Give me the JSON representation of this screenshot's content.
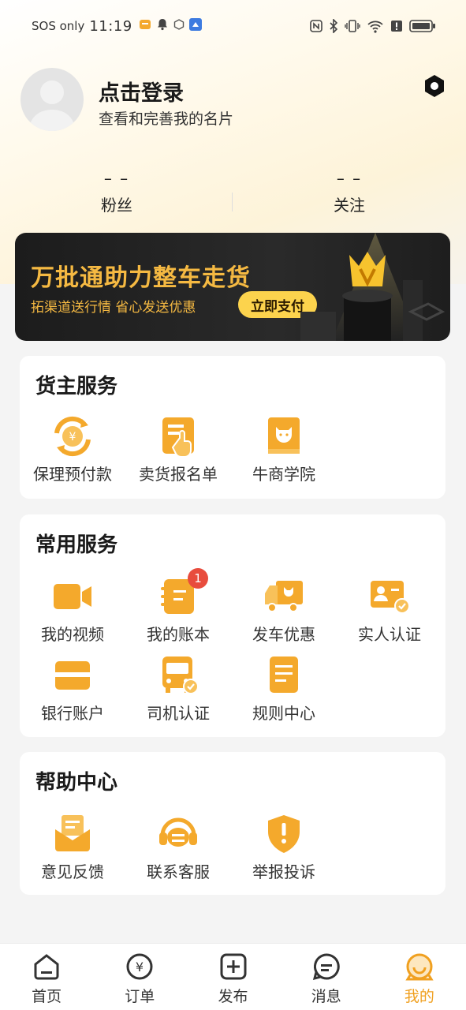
{
  "status_bar": {
    "carrier": "SOS only",
    "time": "11:19"
  },
  "profile": {
    "login_title": "点击登录",
    "login_subtitle": "查看和完善我的名片"
  },
  "stats": [
    {
      "value": "– –",
      "label": "粉丝"
    },
    {
      "value": "– –",
      "label": "关注"
    }
  ],
  "banner": {
    "title": "万批通助力整车走货",
    "subtitle": "拓渠道送行情  省心发送优惠",
    "button_label": "立即支付"
  },
  "owner_services": {
    "title": "货主服务",
    "items": [
      {
        "label": "保理预付款",
        "icon": "prepayment-icon"
      },
      {
        "label": "卖货报名单",
        "icon": "signup-list-icon"
      },
      {
        "label": "牛商学院",
        "icon": "academy-book-icon"
      }
    ]
  },
  "common_services": {
    "title": "常用服务",
    "items": [
      {
        "label": "我的视频",
        "icon": "video-camera-icon"
      },
      {
        "label": "我的账本",
        "icon": "ledger-icon",
        "badge": "1"
      },
      {
        "label": "发车优惠",
        "icon": "truck-discount-icon"
      },
      {
        "label": "实人认证",
        "icon": "id-verify-icon"
      },
      {
        "label": "银行账户",
        "icon": "bank-card-icon"
      },
      {
        "label": "司机认证",
        "icon": "driver-verify-icon"
      },
      {
        "label": "规则中心",
        "icon": "rules-doc-icon"
      }
    ]
  },
  "help_center": {
    "title": "帮助中心",
    "items": [
      {
        "label": "意见反馈",
        "icon": "feedback-mail-icon"
      },
      {
        "label": "联系客服",
        "icon": "customer-service-icon"
      },
      {
        "label": "举报投诉",
        "icon": "report-shield-icon"
      }
    ]
  },
  "bottom_nav": [
    {
      "label": "首页",
      "icon": "home-icon"
    },
    {
      "label": "订单",
      "icon": "order-icon"
    },
    {
      "label": "发布",
      "icon": "publish-plus-icon"
    },
    {
      "label": "消息",
      "icon": "message-icon"
    },
    {
      "label": "我的",
      "icon": "profile-icon",
      "active": true
    }
  ],
  "colors": {
    "accent": "#f5b942",
    "icon_orange": "#f4a92c",
    "badge_red": "#e84c3d",
    "active_nav": "#f0a020",
    "banner_bg": "#1c1c1c"
  }
}
